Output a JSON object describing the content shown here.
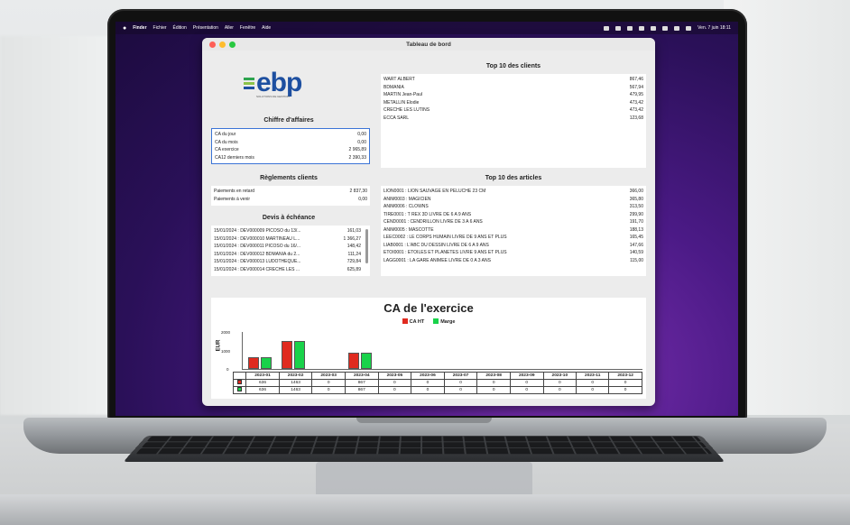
{
  "menubar": {
    "items": [
      "Finder",
      "Fichier",
      "Édition",
      "Présentation",
      "Aller",
      "Fenêtre",
      "Aide"
    ],
    "clock": "Ven. 7 juin 18:11"
  },
  "window": {
    "title": "Tableau de bord"
  },
  "logo": {
    "text": "ebp",
    "tagline": "SOLUTIONS DE GESTION"
  },
  "chiffre_affaires": {
    "title": "Chiffre d'affaires",
    "rows": [
      {
        "label": "CA du jour",
        "value": "0,00"
      },
      {
        "label": "CA du mois",
        "value": "0,00"
      },
      {
        "label": "CA exercice",
        "value": "2 965,89"
      },
      {
        "label": "CA12 derniers mois",
        "value": "2 390,33"
      }
    ]
  },
  "reglements": {
    "title": "Règlements clients",
    "rows": [
      {
        "label": "Paiements en retard",
        "value": "2 837,30"
      },
      {
        "label": "Paiements à venir",
        "value": "0,00"
      }
    ]
  },
  "devis": {
    "title": "Devis à échéance",
    "rows": [
      {
        "label": "15/01/2024 : DEV000009 PICOSO du 13/...",
        "value": "161,03"
      },
      {
        "label": "15/01/2024 : DEV000010 MARTINEAU L...",
        "value": "1 366,27"
      },
      {
        "label": "15/01/2024 : DEV000011 PICOSO du 16/...",
        "value": "148,42"
      },
      {
        "label": "15/01/2024 : DEV000012 BDMANIA du 2...",
        "value": "111,24"
      },
      {
        "label": "15/01/2024 : DEV000013 LUDOTHEQUE...",
        "value": "729,84"
      },
      {
        "label": "15/01/2024 : DEV000014 CRECHE LES ...",
        "value": "625,89"
      }
    ]
  },
  "top_clients": {
    "title": "Top 10 des clients",
    "rows": [
      {
        "label": "WART ALBERT",
        "value": "867,46"
      },
      {
        "label": "BDMANIA",
        "value": "567,94"
      },
      {
        "label": "MARTIN Jean-Paul",
        "value": "479,95"
      },
      {
        "label": "METALLIN Elodie",
        "value": "473,42"
      },
      {
        "label": "CRECHE LES LUTINS",
        "value": "473,42"
      },
      {
        "label": "ECCA SARL",
        "value": "123,68"
      }
    ]
  },
  "top_articles": {
    "title": "Top 10 des articles",
    "rows": [
      {
        "label": "LION0001 : LION SAUVAGE EN PELUCHE 23 CM",
        "value": "366,00"
      },
      {
        "label": "ANIM0003 : MAGICIEN",
        "value": "365,80"
      },
      {
        "label": "ANIM0006 : CLOWNS",
        "value": "313,50"
      },
      {
        "label": "TIRE0001 : T REX 3D LIVRE DE 6 A 9 ANS",
        "value": "299,90"
      },
      {
        "label": "CEND0001 : CENDRILLON LIVRE DE 3 A 6 ANS",
        "value": "191,70"
      },
      {
        "label": "ANIM0005 : MASCOTTE",
        "value": "188,13"
      },
      {
        "label": "LEEC0002 : LE CORPS HUMAIN LIVRE DE 9 ANS ET PLUS",
        "value": "165,45"
      },
      {
        "label": "LIAB0001 : L'ABC DU DESSIN LIVRE DE 6 A 9 ANS",
        "value": "147,66"
      },
      {
        "label": "ETOI0001 : ETOILES ET PLANETES LIVRE 9 ANS ET PLUS",
        "value": "140,59"
      },
      {
        "label": "LAGG0001 : LA GARE ANIMEE LIVRE DE 0 A 3 ANS",
        "value": "115,00"
      }
    ]
  },
  "chart_data": {
    "type": "bar",
    "title": "CA de l'exercice",
    "ylabel": "EUR",
    "ylim": [
      0,
      2000
    ],
    "yticks": [
      "2000",
      "1000",
      "0"
    ],
    "categories": [
      "2023-01",
      "2023-02",
      "2023-03",
      "2023-04",
      "2023-05",
      "2023-06",
      "2023-07",
      "2023-08",
      "2023-09",
      "2023-10",
      "2023-11",
      "2023-12"
    ],
    "series": [
      {
        "name": "CA HT",
        "color": "#e02a1f",
        "values": [
          636,
          1463,
          0,
          867,
          0,
          0,
          0,
          0,
          0,
          0,
          0,
          0
        ]
      },
      {
        "name": "Marge",
        "color": "#19d24a",
        "values": [
          636,
          1463,
          0,
          867,
          0,
          0,
          0,
          0,
          0,
          0,
          0,
          0
        ]
      }
    ],
    "legend": "top-center"
  }
}
